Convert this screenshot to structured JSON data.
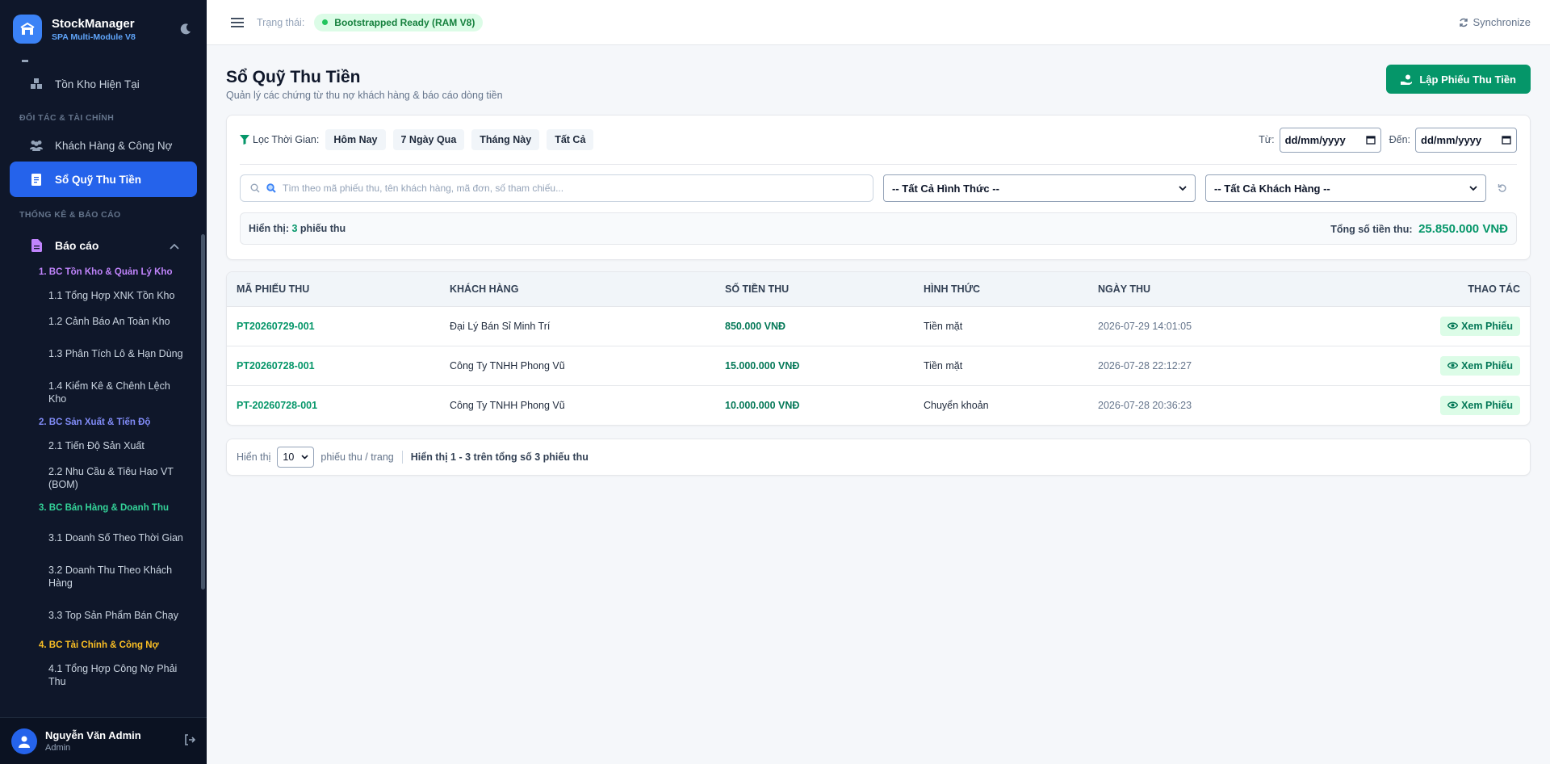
{
  "brand": {
    "name": "StockManager",
    "subtitle": "SPA Multi-Module V8"
  },
  "sidebar": {
    "top_items": [
      {
        "label": "Tồn Kho Hiện Tại"
      }
    ],
    "section_partner": "ĐỐI TÁC & TÀI CHÍNH",
    "partner_items": [
      {
        "label": "Khách Hàng & Công Nợ"
      },
      {
        "label": "Sổ Quỹ Thu Tiền",
        "active": true
      }
    ],
    "section_report": "THỐNG KÊ & BÁO CÁO",
    "report_group": "Báo cáo",
    "report_subgroups": [
      {
        "title": "1. BC Tồn Kho & Quản Lý Kho",
        "color": "#c084fc",
        "items": [
          "1.1 Tổng Hợp XNK Tồn Kho",
          "1.2 Cảnh Báo An Toàn Kho",
          "1.3 Phân Tích Lô & Hạn Dùng",
          "1.4 Kiểm Kê & Chênh Lệch Kho"
        ]
      },
      {
        "title": "2. BC Sản Xuất & Tiến Độ",
        "color": "#818cf8",
        "items": [
          "2.1 Tiến Độ Sản Xuất",
          "2.2 Nhu Cầu & Tiêu Hao VT (BOM)"
        ]
      },
      {
        "title": "3. BC Bán Hàng & Doanh Thu",
        "color": "#34d399",
        "items": [
          "3.1 Doanh Số Theo Thời Gian",
          "3.2 Doanh Thu Theo Khách Hàng",
          "3.3 Top Sản Phẩm Bán Chạy"
        ]
      },
      {
        "title": "4. BC Tài Chính & Công Nợ",
        "color": "#fbbf24",
        "items": [
          "4.1 Tổng Hợp Công Nợ Phải Thu"
        ]
      }
    ],
    "user": {
      "name": "Nguyễn Văn Admin",
      "role": "Admin"
    }
  },
  "topbar": {
    "status_label": "Trạng thái:",
    "status_value": "Bootstrapped Ready (RAM V8)",
    "sync_label": "Synchronize"
  },
  "page": {
    "title": "Sổ Quỹ Thu Tiền",
    "subtitle": "Quản lý các chứng từ thu nợ khách hàng & báo cáo dòng tiền",
    "primary_button": "Lập Phiếu Thu Tiền"
  },
  "filters": {
    "time_label": "Lọc Thời Gian:",
    "chips": [
      "Hôm Nay",
      "7 Ngày Qua",
      "Tháng Này",
      "Tất Cả"
    ],
    "from_label": "Từ:",
    "to_label": "Đến:",
    "from_value": "dd/mm/yyyy",
    "to_value": "dd/mm/yyyy",
    "search_placeholder": "Tìm theo mã phiếu thu, tên khách hàng, mã đơn, số tham chiếu...",
    "method_select": "-- Tất Cả Hình Thức --",
    "customer_select": "-- Tất Cả Khách Hàng --"
  },
  "summary": {
    "showing_prefix": "Hiển thị:",
    "count": "3",
    "showing_suffix": "phiếu thu",
    "total_label": "Tổng số tiền thu:",
    "total_value": "25.850.000 VNĐ"
  },
  "table": {
    "headers": [
      "MÃ PHIẾU THU",
      "KHÁCH HÀNG",
      "SỐ TIỀN THU",
      "HÌNH THỨC",
      "NGÀY THU",
      "THAO TÁC"
    ],
    "action_label": "Xem Phiếu",
    "rows": [
      {
        "code": "PT20260729-001",
        "customer": "Đại Lý Bán Sỉ Minh Trí",
        "amount": "850.000 VNĐ",
        "method": "Tiền mặt",
        "date": "2026-07-29 14:01:05"
      },
      {
        "code": "PT20260728-001",
        "customer": "Công Ty TNHH Phong Vũ",
        "amount": "15.000.000 VNĐ",
        "method": "Tiền mặt",
        "date": "2026-07-28 22:12:27"
      },
      {
        "code": "PT-20260728-001",
        "customer": "Công Ty TNHH Phong Vũ",
        "amount": "10.000.000 VNĐ",
        "method": "Chuyển khoản",
        "date": "2026-07-28 20:36:23"
      }
    ]
  },
  "pager": {
    "show_label": "Hiển thị",
    "page_size": "10",
    "per_page_label": "phiếu thu / trang",
    "info": "Hiển thị 1 - 3 trên tổng số 3 phiếu thu"
  }
}
